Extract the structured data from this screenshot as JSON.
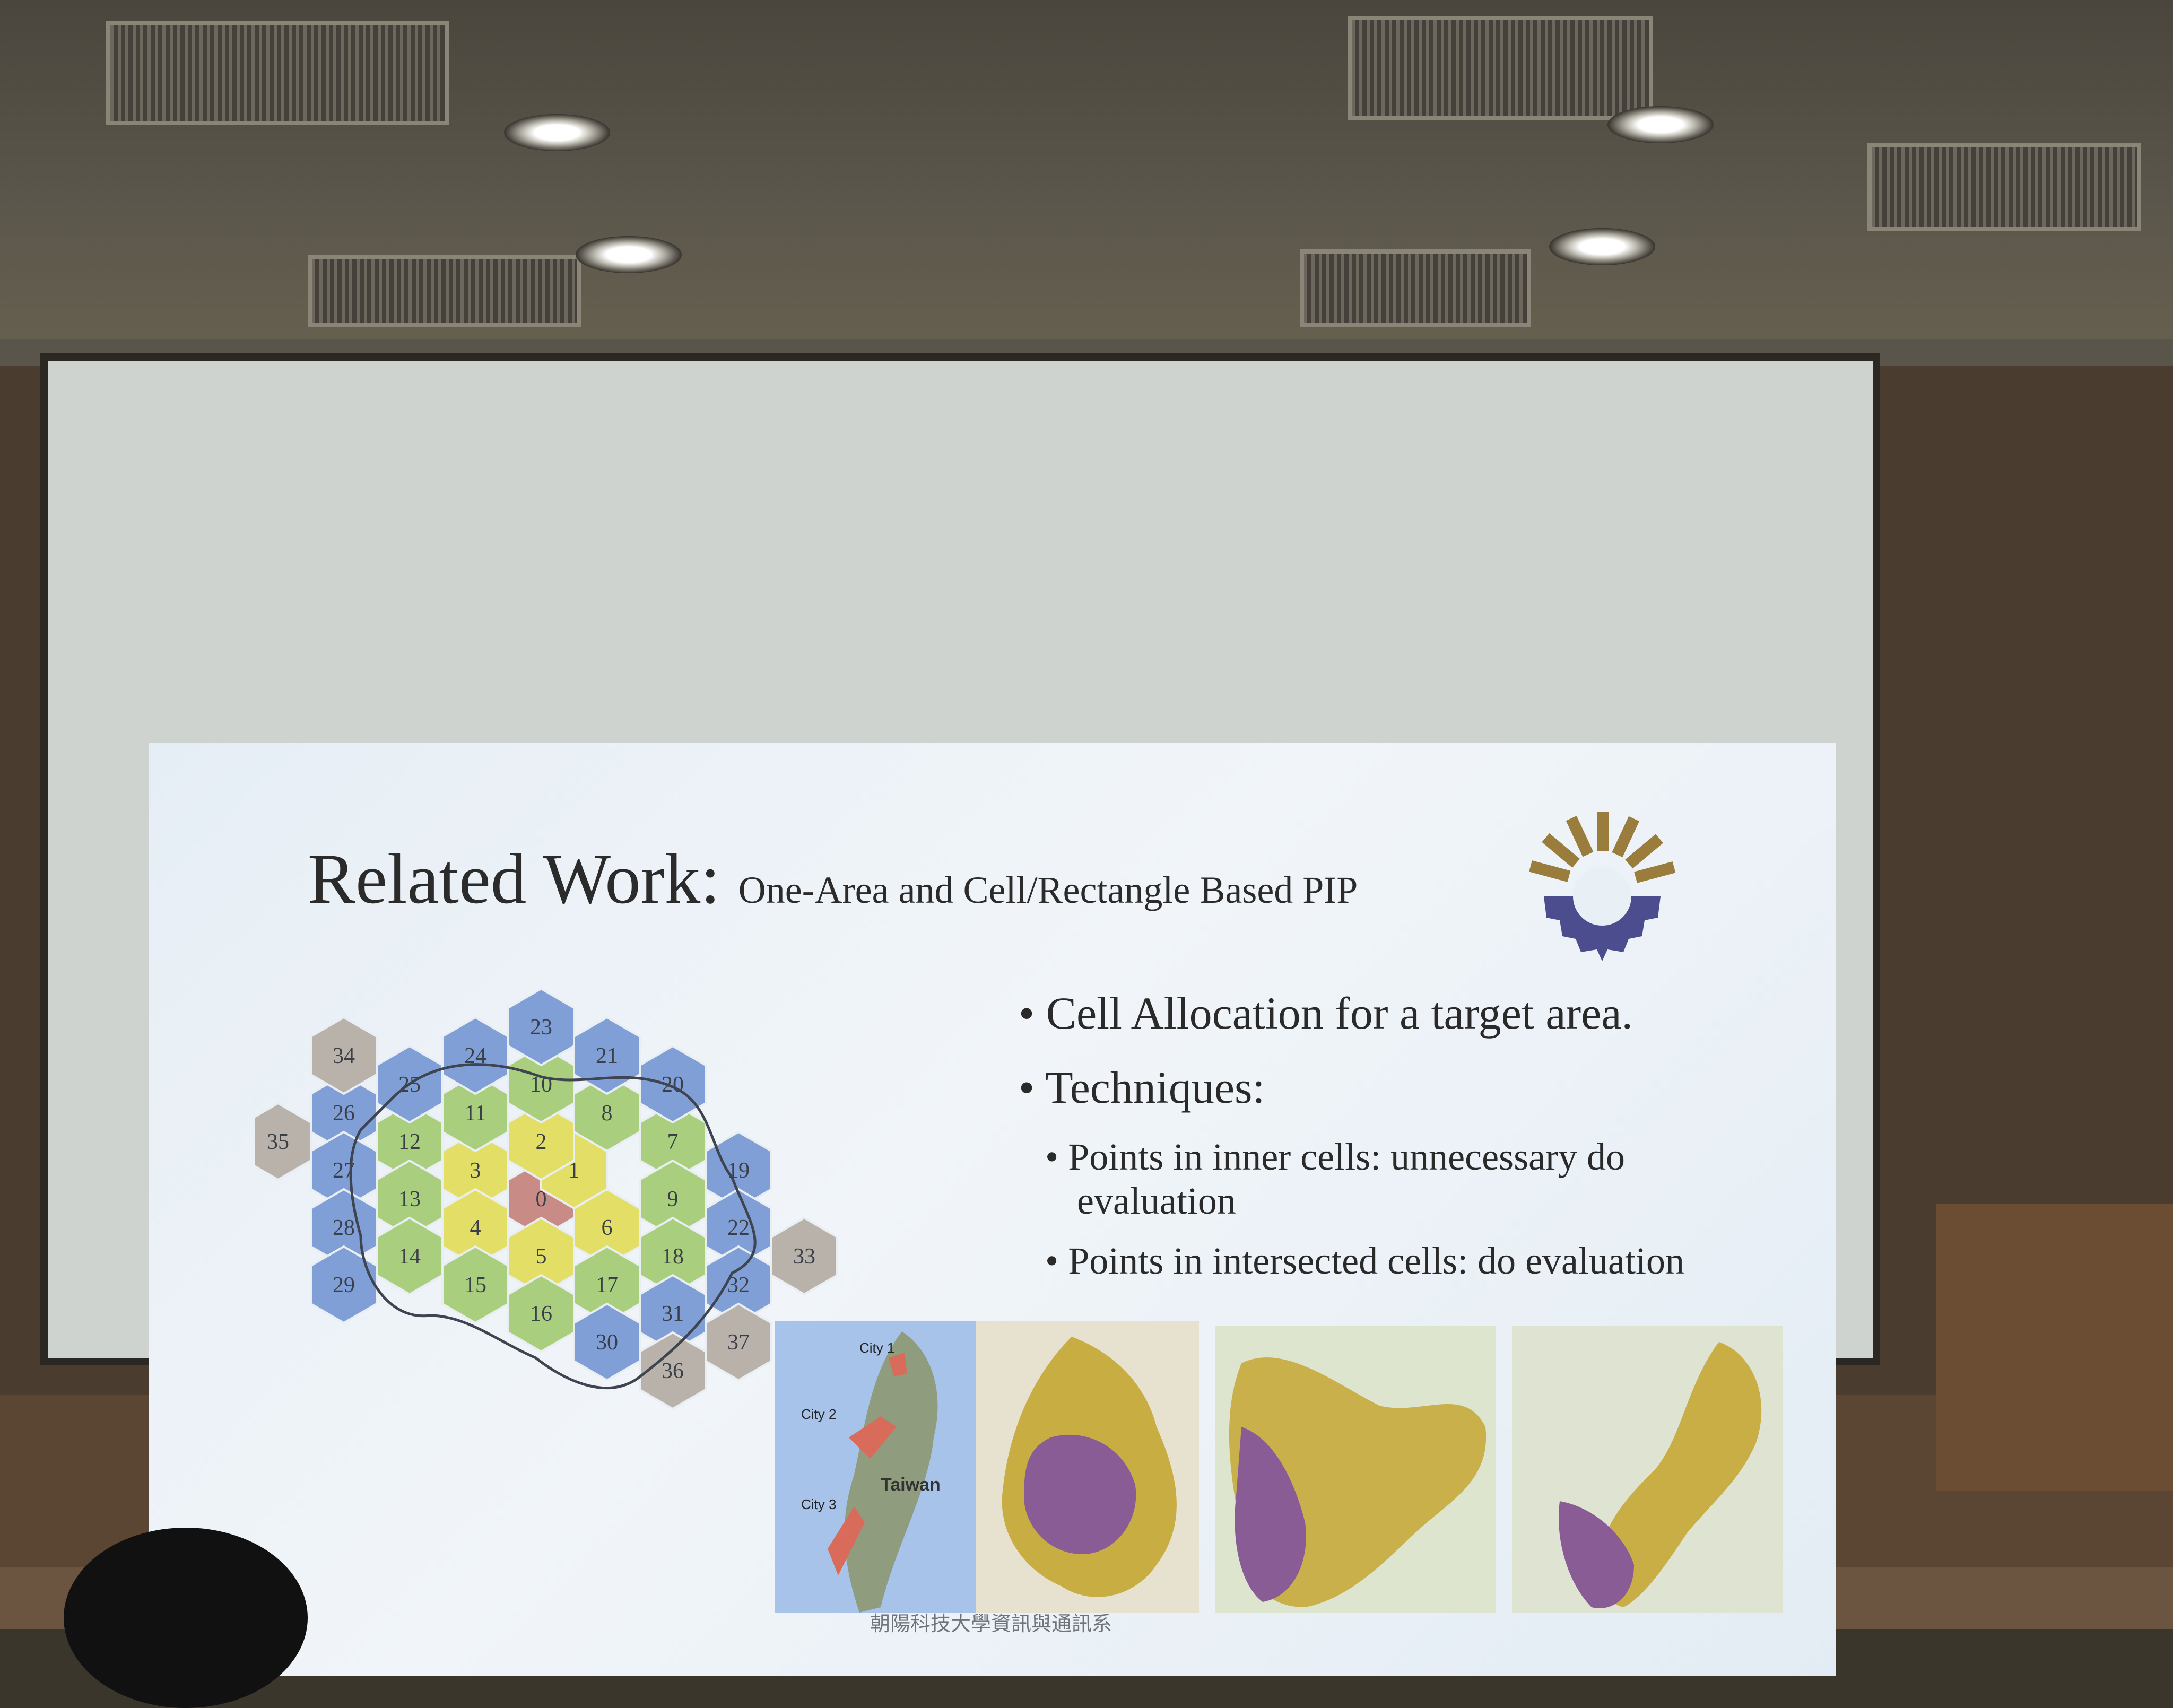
{
  "slide": {
    "title": "Related Work:",
    "subtitle": "One-Area and Cell/Rectangle Based PIP",
    "bullets": {
      "b1": "Cell Allocation for a target area.",
      "b2": "Techniques:",
      "b2_1": "Points in inner cells: unnecessary do evaluation",
      "b2_2": "Points in intersected cells: do evaluation"
    },
    "hex_labels": [
      "0",
      "1",
      "2",
      "3",
      "4",
      "5",
      "6",
      "7",
      "8",
      "9",
      "10",
      "11",
      "12",
      "13",
      "14",
      "15",
      "16",
      "17",
      "18",
      "19",
      "20",
      "21",
      "22",
      "23",
      "24",
      "25",
      "26",
      "27",
      "28",
      "29",
      "30",
      "31",
      "32",
      "33",
      "34",
      "35",
      "36",
      "37"
    ],
    "map_labels": {
      "city1": "City 1",
      "city2": "City 2",
      "city3": "City 3",
      "taiwan": "Taiwan"
    },
    "footer": "朝陽科技大學資訊與通訊系",
    "colors": {
      "ring0": "#c98b86",
      "ring1": "#e3de66",
      "ring2": "#a9cf7e",
      "ring3": "#7f9fd6",
      "outer": "#b8b2aa",
      "logo_blue": "#4b4d8f",
      "logo_gold": "#9a7d3c"
    }
  }
}
